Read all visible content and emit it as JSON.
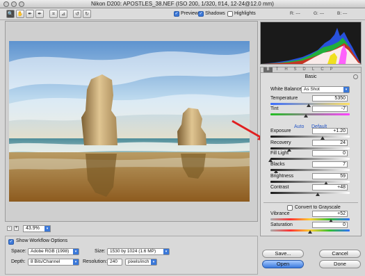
{
  "window": {
    "title": "Nikon D200:  APOSTLES_38.NEF  (ISO 200, 1/320, f/14, 12-24@12.0 mm)"
  },
  "toolbar": {
    "tools": [
      {
        "name": "zoom-tool",
        "glyph": "🔍",
        "active": true
      },
      {
        "name": "hand-tool",
        "glyph": "✋",
        "active": false
      },
      {
        "name": "white-balance-tool",
        "glyph": "✒",
        "active": false
      },
      {
        "name": "color-sampler-tool",
        "glyph": "✒",
        "active": false
      },
      {
        "name": "crop-tool",
        "glyph": "⌗",
        "active": false
      },
      {
        "name": "straighten-tool",
        "glyph": "⊿",
        "active": false
      },
      {
        "name": "rotate-left-tool",
        "glyph": "↺",
        "active": false
      },
      {
        "name": "rotate-right-tool",
        "glyph": "↻",
        "active": false
      }
    ],
    "preview_label": "Preview",
    "shadows_label": "Shadows",
    "highlights_label": "Highlights",
    "r_label": "R:",
    "g_label": "G:",
    "b_label": "B:",
    "r_value": "---",
    "g_value": "---",
    "b_value": "---"
  },
  "zoom": {
    "minus": "-",
    "plus": "+",
    "value": "43.9%"
  },
  "workflow": {
    "show_label": "Show Workflow Options",
    "space_label": "Space:",
    "space_value": "Adobe RGB (1998)",
    "size_label": "Size:",
    "size_value": "1530 by 1024  (1.6 MP)",
    "depth_label": "Depth:",
    "depth_value": "8 Bits/Channel",
    "resolution_label": "Resolution:",
    "resolution_value": "240",
    "resolution_unit": "pixels/inch"
  },
  "tabs": [
    "B",
    "T",
    "H",
    "S",
    "D",
    "L",
    "C",
    "P"
  ],
  "panel": {
    "title": "Basic",
    "white_balance_label": "White Balance:",
    "white_balance_value": "As Shot",
    "auto_label": "Auto",
    "default_label": "Default",
    "grayscale_label": "Convert to Grayscale",
    "sliders": [
      {
        "key": "temperature",
        "label": "Temperature",
        "value": "5350",
        "pos": 0.48
      },
      {
        "key": "tint",
        "label": "Tint",
        "value": "-7",
        "pos": 0.45
      },
      {
        "key": "exposure",
        "label": "Exposure",
        "value": "+1.20",
        "pos": 0.66
      },
      {
        "key": "recovery",
        "label": "Recovery",
        "value": "24",
        "pos": 0.24
      },
      {
        "key": "fill-light",
        "label": "Fill Light",
        "value": "0",
        "pos": 0.0
      },
      {
        "key": "blacks",
        "label": "Blacks",
        "value": "7",
        "pos": 0.07
      },
      {
        "key": "brightness",
        "label": "Brightness",
        "value": "59",
        "pos": 0.7
      },
      {
        "key": "contrast",
        "label": "Contrast",
        "value": "+48",
        "pos": 0.6
      },
      {
        "key": "vibrance",
        "label": "Vibrance",
        "value": "+52",
        "pos": 0.76
      },
      {
        "key": "saturation",
        "label": "Saturation",
        "value": "0",
        "pos": 0.5
      }
    ]
  },
  "buttons": {
    "save": "Save...",
    "cancel": "Cancel",
    "open": "Open",
    "done": "Done"
  },
  "colors": {
    "accent": "#3b78d8",
    "annotation_arrow": "#e02020"
  }
}
